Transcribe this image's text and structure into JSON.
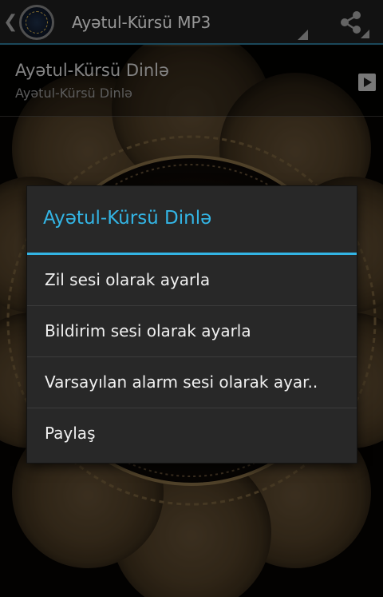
{
  "action_bar": {
    "title": "Ayətul-Kürsü MP3",
    "up_icon": "chevron-left-icon",
    "app_icon": "app-logo-icon",
    "share_icon": "share-icon"
  },
  "list": {
    "items": [
      {
        "title": "Ayətul-Kürsü Dinlə",
        "subtitle": "Ayətul-Kürsü Dinlə",
        "action_icon": "play-icon"
      }
    ]
  },
  "dialog": {
    "title": "Ayətul-Kürsü Dinlə",
    "options": [
      "Zil sesi olarak ayarla",
      "Bildirim sesi olarak ayarla",
      "Varsayılan alarm sesi olarak ayar..",
      "Paylaş"
    ]
  },
  "colors": {
    "accent": "#33b5e5",
    "dialog_bg": "#282828",
    "action_bar_bg": "#1c1c1c",
    "action_bar_border": "#2a6f8a"
  }
}
